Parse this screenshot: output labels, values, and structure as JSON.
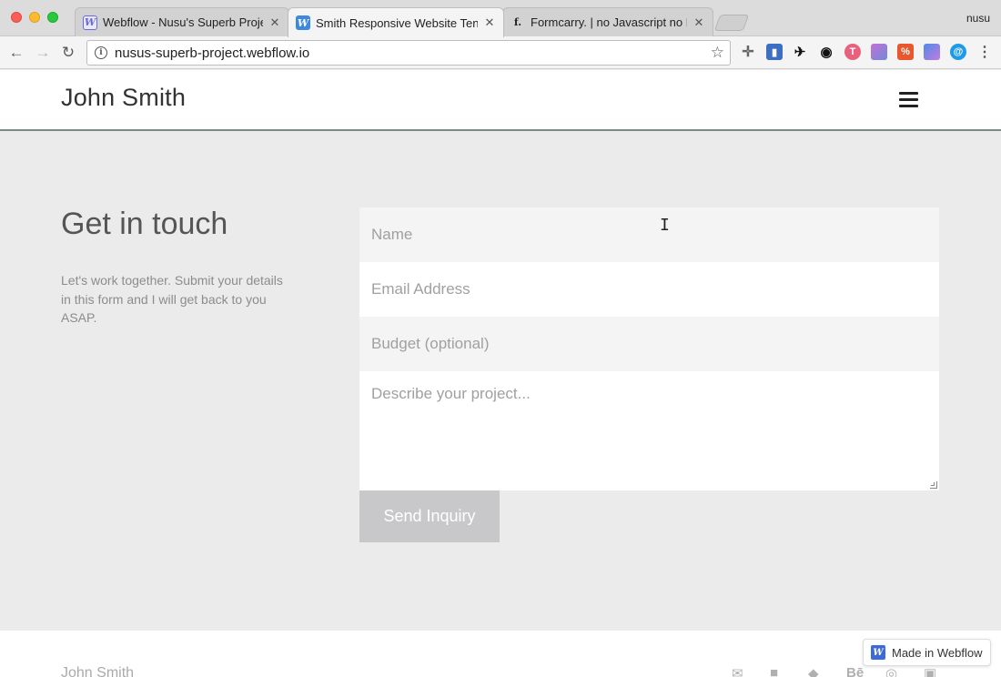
{
  "browser": {
    "tabs": [
      {
        "title": "Webflow - Nusu's Superb Proje",
        "favicon": "W",
        "favicon_color": "#6b6bd6"
      },
      {
        "title": "Smith Responsive Website Ten",
        "favicon": "W",
        "favicon_color": "#3d88e0"
      },
      {
        "title": "Formcarry. | no Javascript no P",
        "favicon": "f.",
        "favicon_color": "#222222"
      }
    ],
    "profile_name": "nusu",
    "url": "nusus-superb-project.webflow.io",
    "close_glyph": "✕"
  },
  "site": {
    "brand": "John Smith",
    "heading": "Get in touch",
    "lede": "Let's work together. Submit your details in this form and I will get back to you ASAP.",
    "form": {
      "name_placeholder": "Name",
      "email_placeholder": "Email Address",
      "budget_placeholder": "Budget (optional)",
      "project_placeholder": "Describe your project...",
      "submit_label": "Send Inquiry"
    },
    "footer_brand": "John Smith",
    "badge_label": "Made in Webflow"
  },
  "colors": {
    "page_bg": "#ebebeb",
    "field_grey": "#f4f4f5",
    "button_bg": "#c8c8ca",
    "webflow_blue": "#3d6ad8"
  }
}
